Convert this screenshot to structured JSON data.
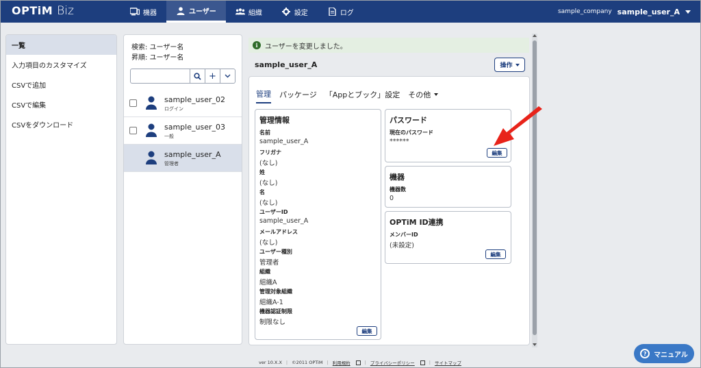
{
  "header": {
    "logo_text": "OPTiM",
    "logo_sub": "Biz",
    "nav": [
      {
        "label": "機器",
        "icon": "device-icon"
      },
      {
        "label": "ユーザー",
        "icon": "user-icon"
      },
      {
        "label": "組織",
        "icon": "org-icon"
      },
      {
        "label": "設定",
        "icon": "gear-icon"
      },
      {
        "label": "ログ",
        "icon": "log-icon"
      }
    ],
    "company": "sample_company",
    "user": "sample_user_A"
  },
  "leftmenu": {
    "items": [
      "一覧",
      "入力項目のカスタマイズ",
      "CSVで追加",
      "CSVで編集",
      "CSVをダウンロード"
    ]
  },
  "userlist": {
    "search_label": "検索: ユーザー名",
    "sort_label": "昇順: ユーザー名",
    "search_placeholder": "",
    "rows": [
      {
        "name": "sample_user_02",
        "role": "ログイン"
      },
      {
        "name": "sample_user_03",
        "role": "一般"
      },
      {
        "name": "sample_user_A",
        "role": "管理者"
      }
    ]
  },
  "notice": "ユーザーを変更しました。",
  "main": {
    "title": "sample_user_A",
    "ops_label": "操作",
    "tabs": [
      "管理",
      "パッケージ",
      "「Appとブック」設定",
      "その他"
    ]
  },
  "mgmt": {
    "title": "管理情報",
    "fields": [
      {
        "label": "名前",
        "value": "sample_user_A"
      },
      {
        "label": "フリガナ",
        "value": "(なし)"
      },
      {
        "label": "姓",
        "value": "(なし)"
      },
      {
        "label": "名",
        "value": "(なし)"
      },
      {
        "label": "ユーザーID",
        "value": "sample_user_A"
      },
      {
        "label": "メールアドレス",
        "value": "(なし)"
      },
      {
        "label": "ユーザー種別",
        "value": "管理者"
      },
      {
        "label": "組織",
        "value": "組織A"
      },
      {
        "label": "管理対象組織",
        "value": "組織A-1"
      },
      {
        "label": "機器認証制限",
        "value": "制限なし"
      }
    ],
    "edit_label": "編集"
  },
  "password": {
    "title": "パスワード",
    "label": "現在のパスワード",
    "value": "******",
    "edit_label": "編集"
  },
  "device": {
    "title": "機器",
    "label": "機器数",
    "value": "0"
  },
  "optim_id": {
    "title": "OPTiM ID連携",
    "label": "メンバーID",
    "value": "(未設定)",
    "edit_label": "編集"
  },
  "footer": {
    "version": "ver 10.X.X",
    "copyright": "©2011 OPTiM",
    "terms": "利用規約",
    "privacy": "プライバシーポリシー",
    "sitemap": "サイトマップ"
  },
  "manual_label": "マニュアル",
  "colors": {
    "header": "#1d3e7e",
    "accent": "#3a78c6",
    "arrow": "#e8231a"
  }
}
